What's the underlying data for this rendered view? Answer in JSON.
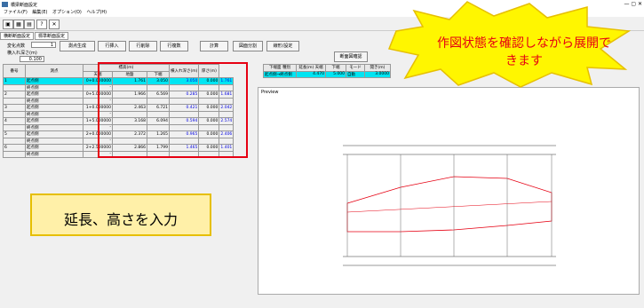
{
  "window": {
    "title": "橋梁断面設定",
    "menu": [
      "ファイル(F)",
      "編集(E)",
      "オプション(O)",
      "ヘルプ(H)"
    ]
  },
  "tabs": [
    "横断断面設定",
    "標準断面設定"
  ],
  "buttons": {
    "measure": "測点生成",
    "insert": "行挿入",
    "delete": "行削除",
    "copy": "行複数",
    "calc": "計算",
    "preview": "図面分割",
    "batch": "線形/設定",
    "show": "断面図確認"
  },
  "fields": {
    "change_point_label": "変化点数",
    "change_point_value": "1",
    "slope_label": "横入れ深さ(m)",
    "slope_value": "0.100"
  },
  "grid": {
    "headers": [
      "番号",
      "測点",
      "標高(m)",
      "",
      "",
      "横入れ深さ(m)",
      "厚さ(m)"
    ],
    "subheaders": [
      "",
      "",
      "天端",
      "地盤",
      "下端",
      "",
      ""
    ],
    "rows": [
      {
        "no": "1",
        "type": "起点側",
        "station": "0+0.000000",
        "top": "1.761",
        "ground": "3.050",
        "bottom": "3.050",
        "depth": "0.000",
        "thick": "1.761",
        "cyan": true
      },
      {
        "no": "",
        "type": "終点側",
        "station": "-",
        "top": "",
        "ground": "",
        "bottom": "",
        "depth": "",
        "thick": "",
        "cyan": false
      },
      {
        "no": "2",
        "type": "起点側",
        "station": "0+5.000000",
        "top": "1.966",
        "ground": "6.569",
        "bottom": "0.285",
        "depth": "0.000",
        "thick": "1.681",
        "cyan": false
      },
      {
        "no": "",
        "type": "終点側",
        "station": "-",
        "top": "",
        "ground": "",
        "bottom": "",
        "depth": "",
        "thick": "",
        "cyan": false
      },
      {
        "no": "3",
        "type": "起点側",
        "station": "1+0.000000",
        "top": "2.463",
        "ground": "6.721",
        "bottom": "0.421",
        "depth": "0.000",
        "thick": "2.042",
        "cyan": false
      },
      {
        "no": "",
        "type": "終点側",
        "station": "-",
        "top": "",
        "ground": "",
        "bottom": "",
        "depth": "",
        "thick": "",
        "cyan": false
      },
      {
        "no": "4",
        "type": "起点側",
        "station": "1+5.000000",
        "top": "3.168",
        "ground": "6.094",
        "bottom": "0.594",
        "depth": "0.000",
        "thick": "2.574",
        "cyan": false
      },
      {
        "no": "",
        "type": "終点側",
        "station": "-",
        "top": "",
        "ground": "",
        "bottom": "",
        "depth": "",
        "thick": "",
        "cyan": false
      },
      {
        "no": "5",
        "type": "起点側",
        "station": "2+0.000000",
        "top": "2.372",
        "ground": "1.265",
        "bottom": "0.965",
        "depth": "0.000",
        "thick": "2.406",
        "cyan": false
      },
      {
        "no": "",
        "type": "終点側",
        "station": "-",
        "top": "",
        "ground": "",
        "bottom": "",
        "depth": "",
        "thick": "",
        "cyan": false
      },
      {
        "no": "6",
        "type": "起点側",
        "station": "2+2.500000",
        "top": "2.866",
        "ground": "1.799",
        "bottom": "1.465",
        "depth": "0.000",
        "thick": "1.401",
        "cyan": false
      },
      {
        "no": "",
        "type": "終点側",
        "station": "-",
        "top": "",
        "ground": "",
        "bottom": "",
        "depth": "",
        "thick": "",
        "cyan": false
      }
    ]
  },
  "right_grid": {
    "headers": [
      "下端面 種別",
      "延長(m) 天端",
      "下端",
      "モード",
      "開き(m)"
    ],
    "row1": [
      "起点側→終点側",
      "4.470",
      "5.000",
      "自動",
      "3.0000"
    ]
  },
  "callouts": {
    "top": "作図状態を確認しながら展開できます",
    "bottom": "延長、高さを入力"
  },
  "preview_label": "Preview"
}
